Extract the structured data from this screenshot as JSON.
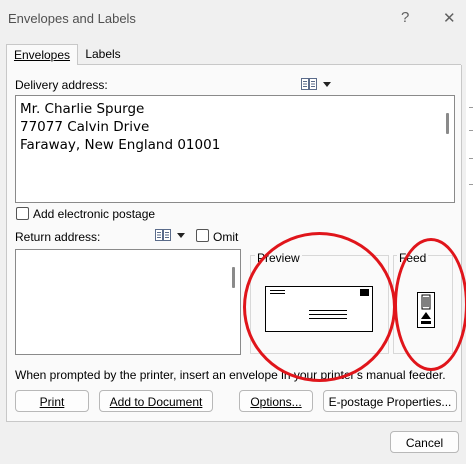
{
  "window": {
    "title": "Envelopes and Labels",
    "help_glyph": "?",
    "close_glyph": "✕"
  },
  "tabs": [
    {
      "label": "Envelopes",
      "active": true
    },
    {
      "label": "Labels",
      "active": false
    }
  ],
  "delivery": {
    "label": "Delivery address:",
    "lines": [
      "Mr. Charlie Spurge",
      "77077 Calvin Drive",
      "Faraway, New England 01001"
    ]
  },
  "electronic_postage": {
    "label": "Add electronic postage",
    "checked": false
  },
  "return_address": {
    "label": "Return address:",
    "value": "",
    "omit_label": "Omit",
    "omit_checked": false
  },
  "preview": {
    "label": "Preview"
  },
  "feed": {
    "label": "Feed"
  },
  "instruction": "When prompted by the printer, insert an envelope in your printer's manual feeder.",
  "buttons": {
    "print": "Print",
    "add_to_document": "Add to Document",
    "options": "Options...",
    "epostage": "E-postage Properties...",
    "cancel": "Cancel"
  },
  "colors": {
    "annotation_red": "#e0151b",
    "dialog_bg": "#f0f0f0",
    "panel_bg": "#fafafa"
  },
  "icons": {
    "address_book": "address-book-icon",
    "dropdown": "chevron-down-icon",
    "envelope_preview": "envelope-icon",
    "feed": "envelope-feed-icon"
  }
}
